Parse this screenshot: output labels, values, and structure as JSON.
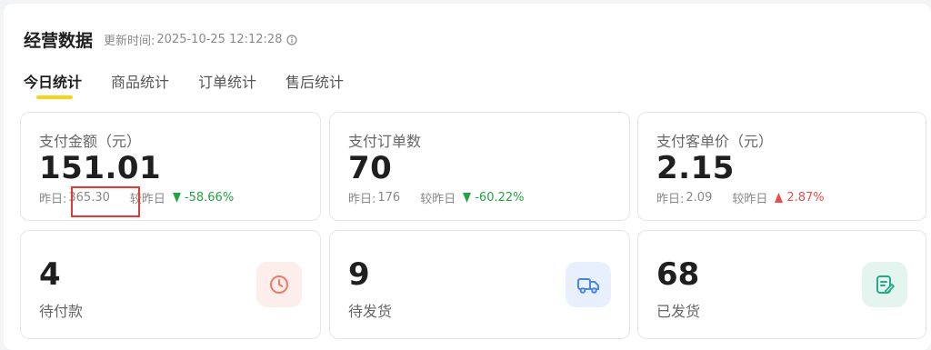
{
  "header": {
    "title": "经营数据",
    "updated_prefix": "更新时间:",
    "updated_time": "2025-10-25 12:12:28"
  },
  "tabs": [
    {
      "label": "今日统计",
      "active": true
    },
    {
      "label": "商品统计",
      "active": false
    },
    {
      "label": "订单统计",
      "active": false
    },
    {
      "label": "售后统计",
      "active": false
    }
  ],
  "metrics": [
    {
      "label": "支付金额（元）",
      "value": "151.01",
      "yesterday_label": "昨日:",
      "yesterday_value": "365.30",
      "compare_label": "较昨日",
      "trend": "down",
      "change": "-58.66%"
    },
    {
      "label": "支付订单数",
      "value": "70",
      "yesterday_label": "昨日:",
      "yesterday_value": "176",
      "compare_label": "较昨日",
      "trend": "down",
      "change": "-60.22%"
    },
    {
      "label": "支付客单价（元）",
      "value": "2.15",
      "yesterday_label": "昨日:",
      "yesterday_value": "2.09",
      "compare_label": "较昨日",
      "trend": "up",
      "change": "2.87%"
    }
  ],
  "status": [
    {
      "value": "4",
      "label": "待付款",
      "icon": "clock-icon",
      "icon_color": "#f07a6a",
      "icon_bg": "#fdeeec"
    },
    {
      "value": "9",
      "label": "待发货",
      "icon": "truck-icon",
      "icon_color": "#4a86e8",
      "icon_bg": "#e8f0fd"
    },
    {
      "value": "68",
      "label": "已发货",
      "icon": "edit-list-icon",
      "icon_color": "#27a889",
      "icon_bg": "#e4f5f0"
    }
  ],
  "colors": {
    "trend_down": "#22a442",
    "trend_up": "#ef4a4a",
    "tab_underline": "#f7d417",
    "highlight_box": "#e53935"
  }
}
